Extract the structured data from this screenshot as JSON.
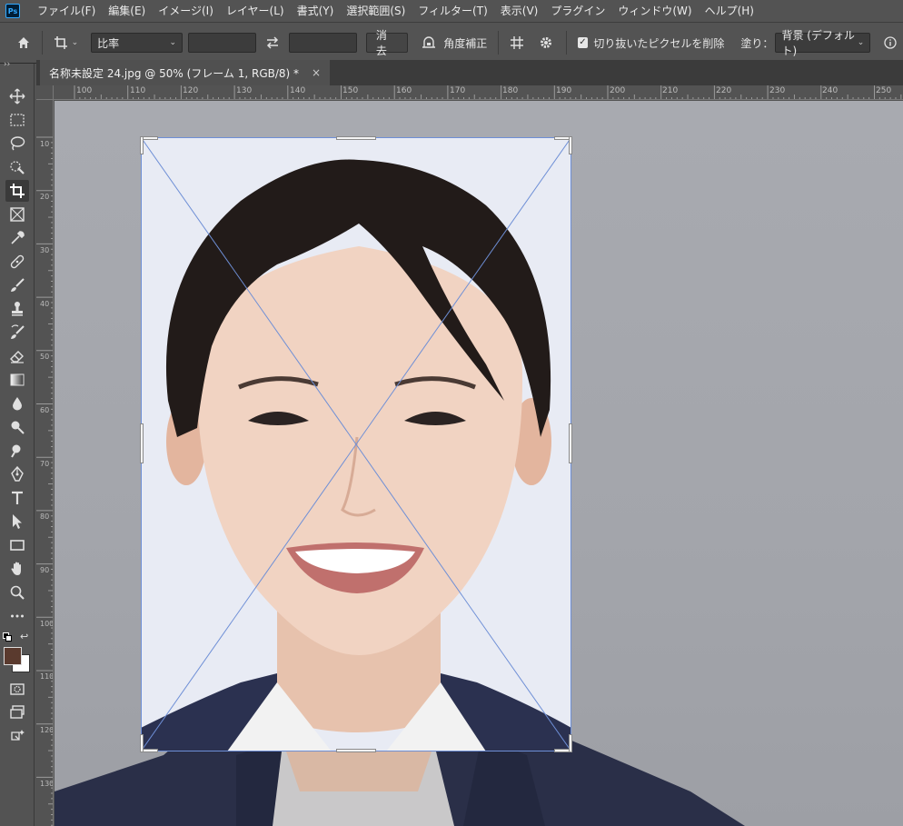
{
  "app": {
    "logo": "Ps"
  },
  "menu": {
    "items": [
      "ファイル(F)",
      "編集(E)",
      "イメージ(I)",
      "レイヤー(L)",
      "書式(Y)",
      "選択範囲(S)",
      "フィルター(T)",
      "表示(V)",
      "プラグイン",
      "ウィンドウ(W)",
      "ヘルプ(H)"
    ]
  },
  "options": {
    "ratio_select": "比率",
    "clear_button": "消去",
    "straighten_label": "角度補正",
    "delete_cropped_label": "切り抜いたピクセルを削除",
    "fill_label": "塗り：",
    "fill_select": "背景 (デフォルト)"
  },
  "document": {
    "tab_title": "名称未設定 24.jpg @ 50% (フレーム 1, RGB/8) *",
    "close_glyph": "×"
  },
  "ruler_top": [
    "100",
    "110",
    "120",
    "130",
    "140",
    "150",
    "160",
    "170",
    "180",
    "190",
    "200",
    "210",
    "220",
    "230",
    "240",
    "250"
  ],
  "ruler_left": [
    "10",
    "20",
    "30",
    "40",
    "50",
    "60",
    "70",
    "80",
    "90",
    "100",
    "110",
    "120",
    "130"
  ],
  "icons": {
    "home": "home-icon",
    "crop": "crop-icon",
    "swap": "swap-icon",
    "straighten": "level-icon",
    "grid": "grid-icon",
    "settings": "gear-icon",
    "info": "info-icon"
  },
  "colors": {
    "foreground": "#5a3a2e",
    "background": "#ffffff",
    "crop_frame": "#6e8fd6",
    "ui_bg": "#535353"
  }
}
